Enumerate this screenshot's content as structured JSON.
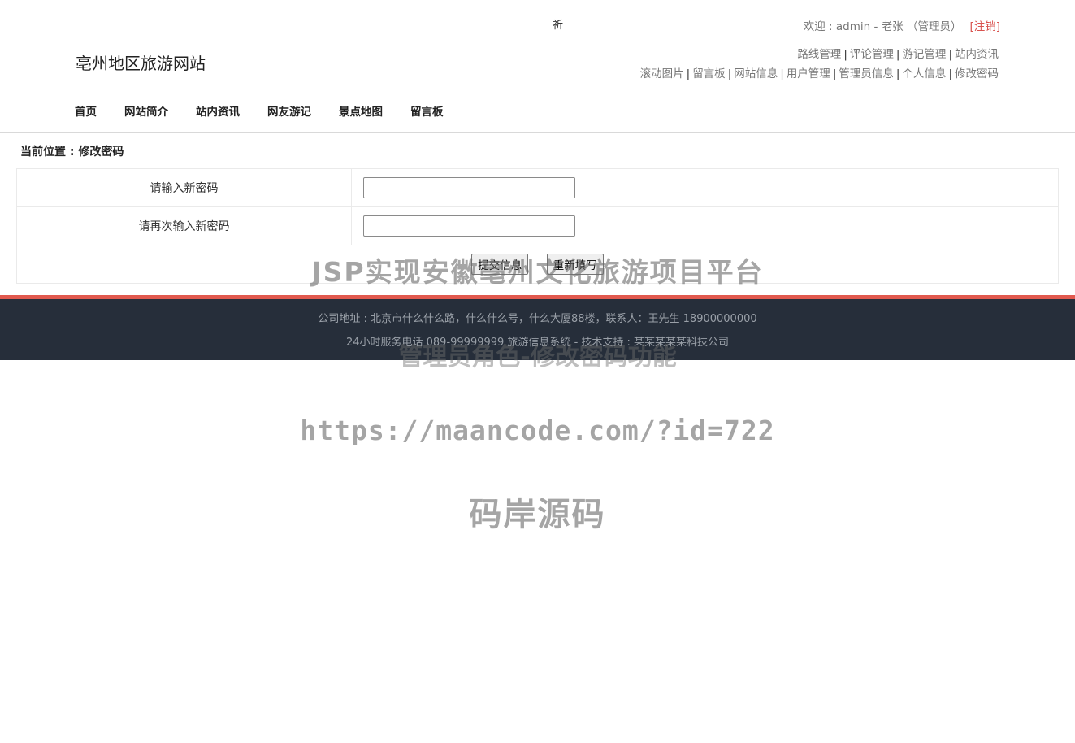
{
  "header": {
    "site_title": "亳州地区旅游网站",
    "glyph": "祈",
    "welcome_text": "欢迎 : admin - 老张 （管理员）",
    "logout_label": "[注销]",
    "admin_links_row1": [
      "路线管理",
      "评论管理",
      "游记管理",
      "站内资讯"
    ],
    "admin_links_row2": [
      "滚动图片",
      "留言板",
      "网站信息",
      "用户管理",
      "管理员信息",
      "个人信息",
      "修改密码"
    ]
  },
  "nav": [
    "首页",
    "网站简介",
    "站内资讯",
    "网友游记",
    "景点地图",
    "留言板"
  ],
  "breadcrumb": "当前位置 : 修改密码",
  "form": {
    "new_password_label": "请输入新密码",
    "confirm_password_label": "请再次输入新密码",
    "new_password_value": "",
    "confirm_password_value": "",
    "submit_label": "提交信息",
    "reset_label": "重新填写"
  },
  "footer": {
    "line1": "公司地址 : 北京市什么什么路，什么什么号，什么大厦88楼，联系人：王先生 18900000000",
    "line2": "24小时服务电话   089-99999999   旅游信息系统 - 技术支持 : 某某某某某科技公司",
    "accent_color": "#e1594e",
    "background_color": "#262e3a"
  },
  "watermark": {
    "line1": "JSP实现安徽亳州文化旅游项目平台",
    "line2": "管理员角色-修改密码功能",
    "line3": "https://maancode.com/?id=722",
    "line4": "码岸源码"
  }
}
